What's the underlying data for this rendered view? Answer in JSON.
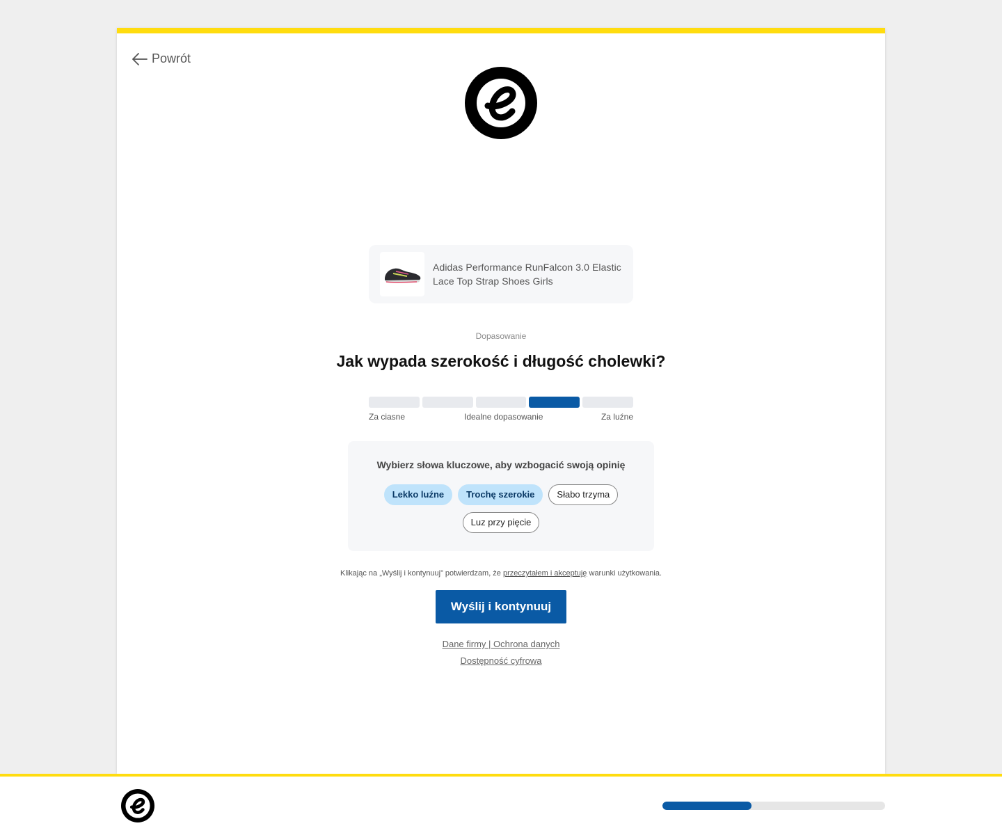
{
  "nav": {
    "back_label": "Powrót"
  },
  "product": {
    "name_line1": "Adidas Performance RunFalcon 3.0 Elastic",
    "name_line2": "Lace Top Strap Shoes Girls"
  },
  "question": {
    "category": "Dopasowanie",
    "title": "Jak wypada szerokość i długość cholewki?",
    "scale_segments": 5,
    "selected_index": 3,
    "labels": {
      "left": "Za ciasne",
      "center": "Idealne dopasowanie",
      "right": "Za luźne"
    }
  },
  "keywords": {
    "title": "Wybierz słowa kluczowe, aby wzbogacić swoją opinię",
    "chips": [
      {
        "label": "Lekko luźne",
        "selected": true
      },
      {
        "label": "Trochę szerokie",
        "selected": true
      },
      {
        "label": "Słabo trzyma",
        "selected": false
      },
      {
        "label": "Luz przy pięcie",
        "selected": false
      }
    ]
  },
  "terms": {
    "before": "Klikając na „Wyślij i kontynuuj” potwierdzam, że ",
    "link": "przeczytałem i akceptuję",
    "after": " warunki użytkowania."
  },
  "submit_label": "Wyślij i kontynuuj",
  "footer": {
    "link1": "Dane firmy | Ochrona danych",
    "link2": "Dostępność cyfrowa"
  },
  "progress": {
    "fraction": 0.4
  },
  "colors": {
    "accent": "#0a5aa5",
    "brand_yellow": "#ffdc0f",
    "chip_selected": "#bfe3fb"
  },
  "icons": {
    "back": "arrow-left-icon",
    "logo": "trusted-shops-e-logo",
    "product": "shoe-image"
  }
}
